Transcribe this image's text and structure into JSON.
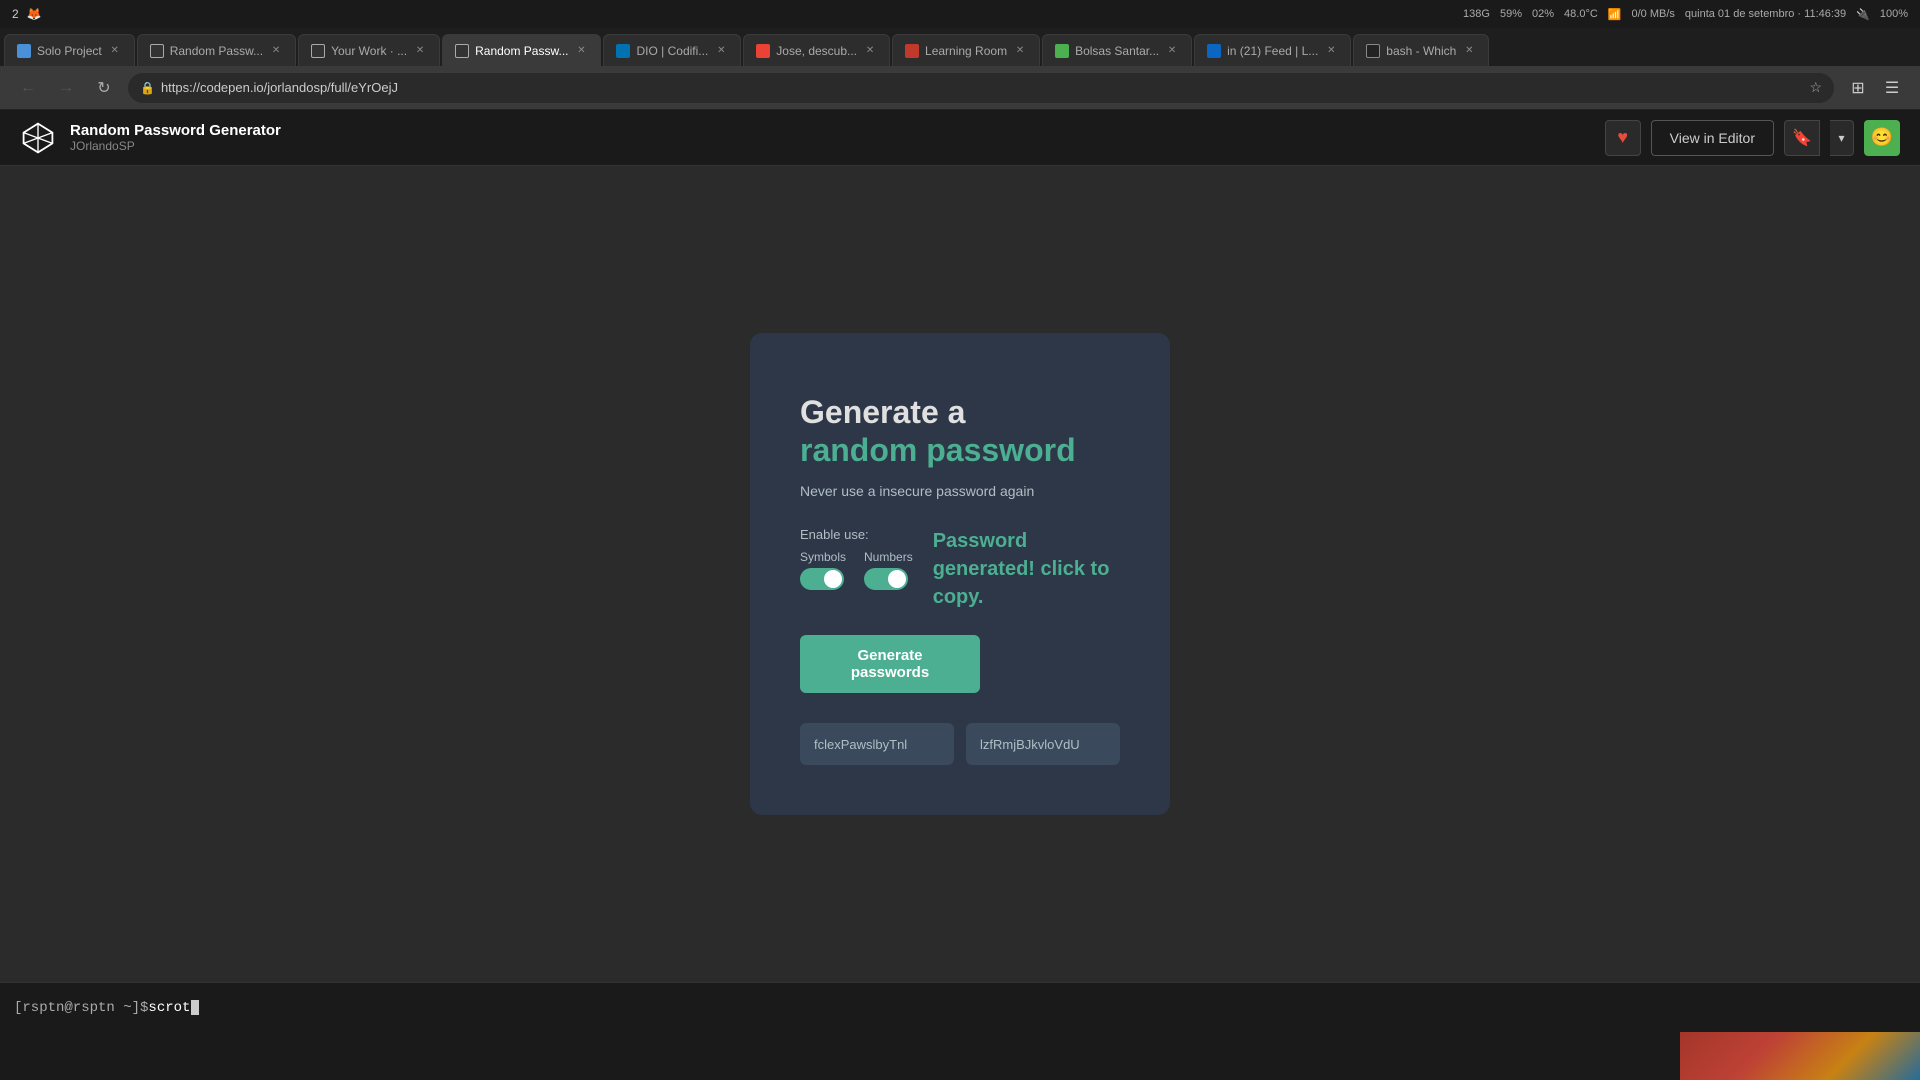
{
  "system_bar": {
    "workspace": "2",
    "cpu": "138G",
    "cpu_percent": "59%",
    "unknown": "02%",
    "temp": "48.0°C",
    "network": "0/0 MB/s",
    "datetime": "quinta 01 de setembro · 11:46:39",
    "battery": "100%"
  },
  "tabs": [
    {
      "id": "tab1",
      "label": "Solo Project",
      "favicon_class": "fav-blue",
      "active": false
    },
    {
      "id": "tab2",
      "label": "Random Passw...",
      "favicon_class": "fav-codepen",
      "active": false
    },
    {
      "id": "tab3",
      "label": "Your Work · ...",
      "favicon_class": "fav-codepen",
      "active": false
    },
    {
      "id": "tab4",
      "label": "Random Passw...",
      "favicon_class": "fav-codepen",
      "active": true
    },
    {
      "id": "tab5",
      "label": "DIO | Codifi...",
      "favicon_class": "fav-dio",
      "active": false
    },
    {
      "id": "tab6",
      "label": "Jose, descub...",
      "favicon_class": "fav-gmail",
      "active": false
    },
    {
      "id": "tab7",
      "label": "Learning Room",
      "favicon_class": "fav-red",
      "active": false
    },
    {
      "id": "tab8",
      "label": "Bolsas Santar...",
      "favicon_class": "fav-green",
      "active": false
    },
    {
      "id": "tab9",
      "label": "in (21) Feed | L...",
      "favicon_class": "fav-linkedin",
      "active": false
    },
    {
      "id": "tab10",
      "label": "bash - Which",
      "favicon_class": "fav-dark",
      "active": false
    }
  ],
  "address_bar": {
    "url": "https://codepen.io/jorlandosp/full/eYrOejJ"
  },
  "codepen_header": {
    "project_title": "Random Password Generator",
    "project_author": "JOrlandoSP",
    "heart_icon": "♥",
    "view_in_editor_label": "View in Editor",
    "bookmark_icon": "🔖",
    "chevron_icon": "▾",
    "avatar_icon": "😊"
  },
  "password_generator": {
    "title_line1": "Generate a",
    "title_line2": "random password",
    "subtitle": "Never use a insecure password again",
    "enable_label": "Enable use:",
    "toggle_symbols_label": "Symbols",
    "toggle_numbers_label": "Numbers",
    "generated_message": "Password generated! click to copy.",
    "generate_btn_label": "Generate passwords",
    "password1": "fclexPawslbyTnl",
    "password2": "lzfRmjBJkvloVdU"
  },
  "terminal": {
    "prompt": "[rsptn@rsptn ~]$ ",
    "command": "scrot"
  }
}
